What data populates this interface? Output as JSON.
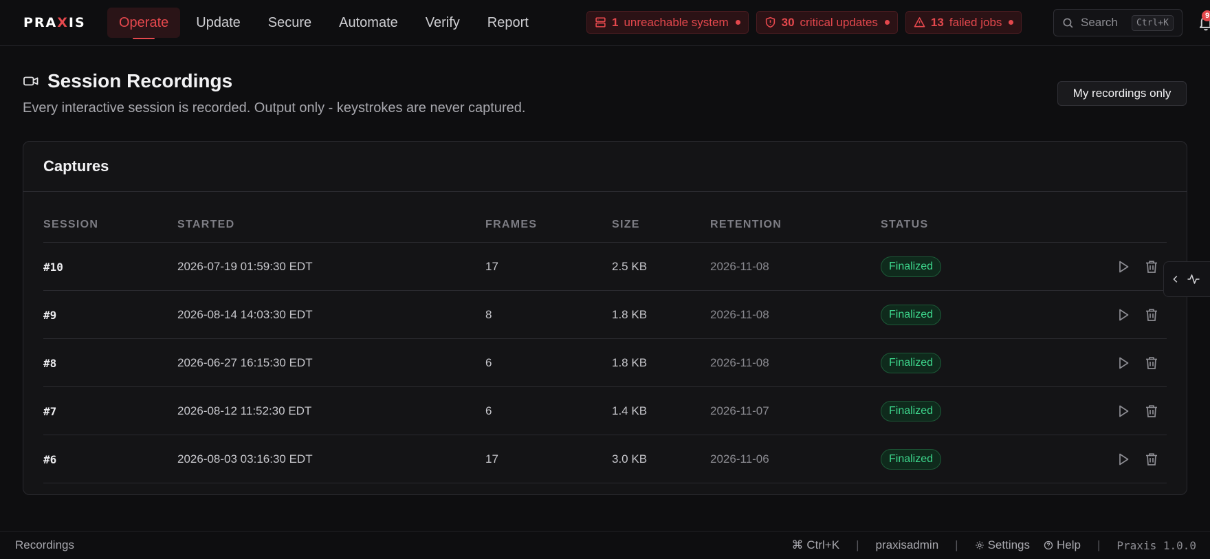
{
  "brand": {
    "pre": "PRA",
    "x": "X",
    "post": "IS"
  },
  "nav": [
    {
      "label": "Operate",
      "active": true
    },
    {
      "label": "Update"
    },
    {
      "label": "Secure"
    },
    {
      "label": "Automate"
    },
    {
      "label": "Verify"
    },
    {
      "label": "Report"
    }
  ],
  "alerts": [
    {
      "icon": "server-icon",
      "count": "1",
      "text": "unreachable system"
    },
    {
      "icon": "shield-icon",
      "count": "30",
      "text": "critical updates"
    },
    {
      "icon": "warning-triangle-icon",
      "count": "13",
      "text": "failed jobs"
    }
  ],
  "search": {
    "placeholder": "Search",
    "shortcut": "Ctrl+K"
  },
  "notifications": {
    "count": "9"
  },
  "page": {
    "title": "Session Recordings",
    "subtitle": "Every interactive session is recorded. Output only - keystrokes are never captured.",
    "filter_button": "My recordings only"
  },
  "card": {
    "title": "Captures"
  },
  "table": {
    "headers": [
      "SESSION",
      "STARTED",
      "FRAMES",
      "SIZE",
      "RETENTION",
      "STATUS"
    ],
    "rows": [
      {
        "session": "#10",
        "started": "2026-07-19 01:59:30 EDT",
        "frames": "17",
        "size": "2.5 KB",
        "retention": "2026-11-08",
        "status": "Finalized"
      },
      {
        "session": "#9",
        "started": "2026-08-14 14:03:30 EDT",
        "frames": "8",
        "size": "1.8 KB",
        "retention": "2026-11-08",
        "status": "Finalized"
      },
      {
        "session": "#8",
        "started": "2026-06-27 16:15:30 EDT",
        "frames": "6",
        "size": "1.8 KB",
        "retention": "2026-11-08",
        "status": "Finalized"
      },
      {
        "session": "#7",
        "started": "2026-08-12 11:52:30 EDT",
        "frames": "6",
        "size": "1.4 KB",
        "retention": "2026-11-07",
        "status": "Finalized"
      },
      {
        "session": "#6",
        "started": "2026-08-03 03:16:30 EDT",
        "frames": "17",
        "size": "3.0 KB",
        "retention": "2026-11-06",
        "status": "Finalized"
      }
    ]
  },
  "footer": {
    "section": "Recordings",
    "shortcut": "Ctrl+K",
    "user": "praxisadmin",
    "settings": "Settings",
    "help": "Help",
    "version": "Praxis 1.0.0"
  },
  "colors": {
    "accent": "#e5484d",
    "success": "#3dd68c",
    "background": "#0e0e10"
  }
}
